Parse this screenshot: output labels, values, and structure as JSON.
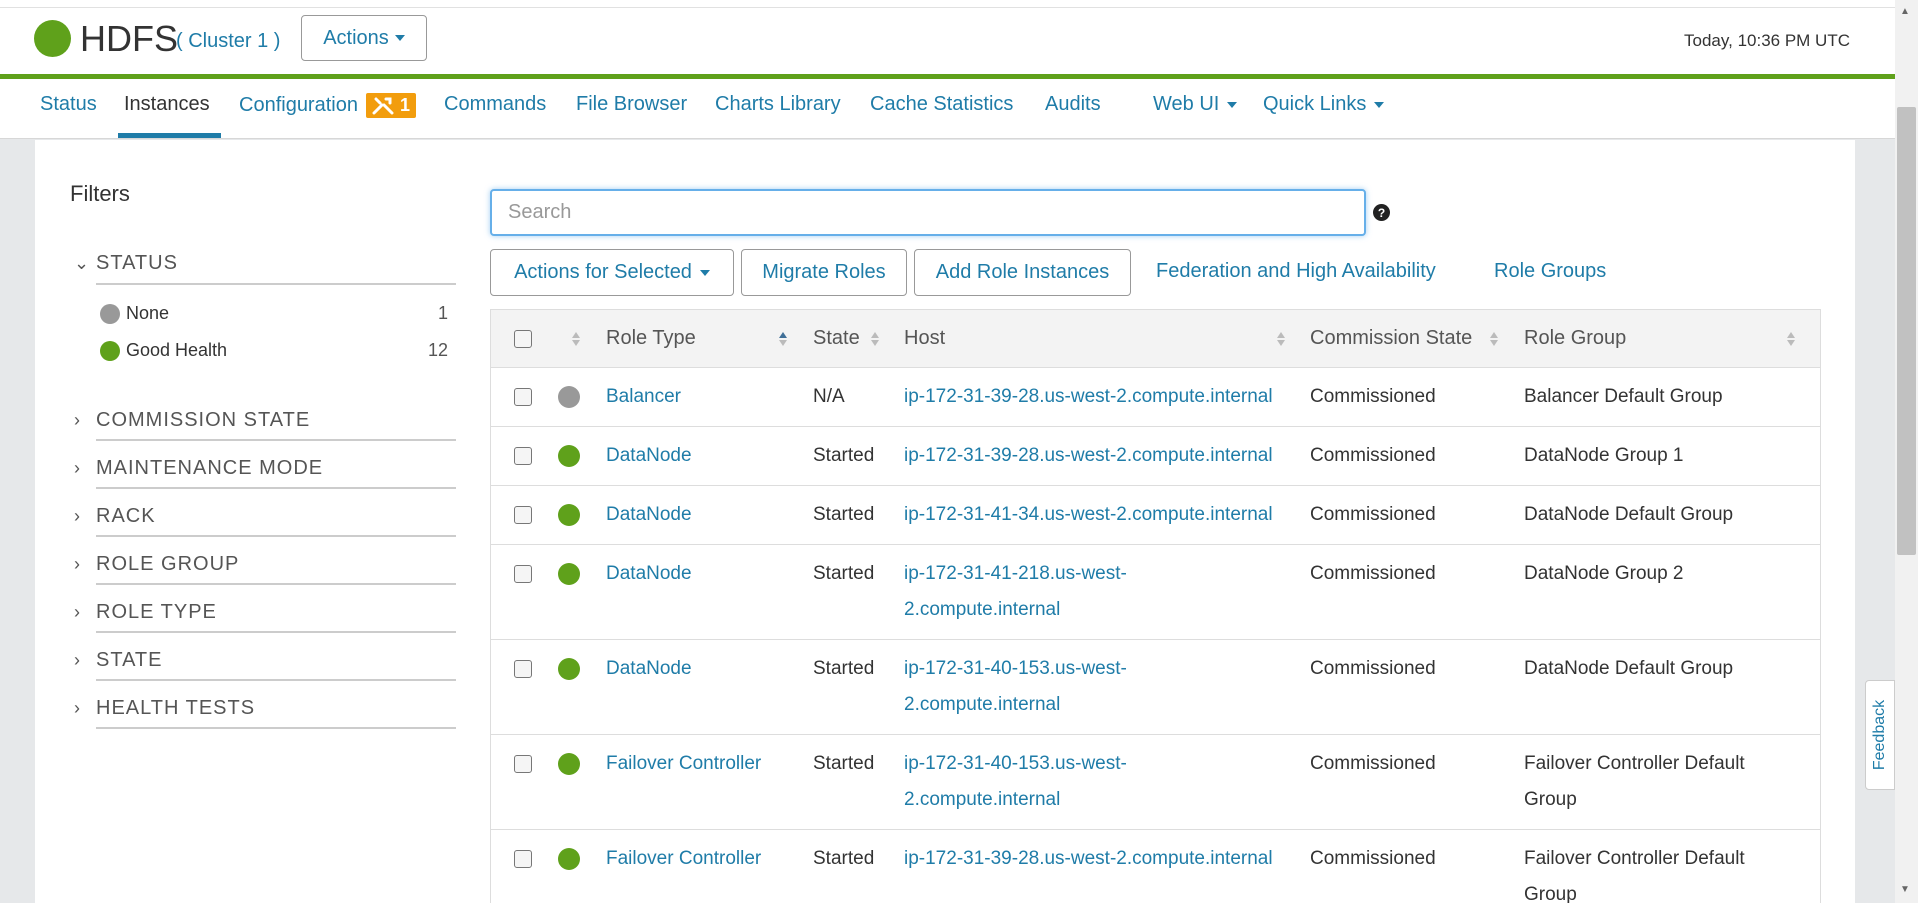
{
  "header": {
    "service": "HDFS",
    "cluster": "( Cluster 1 )",
    "actions_label": "Actions",
    "time": "Today, 10:36 PM UTC"
  },
  "nav": {
    "status": "Status",
    "instances": "Instances",
    "configuration": "Configuration",
    "config_badge": "1",
    "commands": "Commands",
    "file_browser": "File Browser",
    "charts_library": "Charts Library",
    "cache_statistics": "Cache Statistics",
    "audits": "Audits",
    "web_ui": "Web UI",
    "quick_links": "Quick Links"
  },
  "filters": {
    "title": "Filters",
    "status": {
      "label": "STATUS",
      "options": [
        {
          "label": "None",
          "count": "1",
          "color": "#999999"
        },
        {
          "label": "Good Health",
          "count": "12",
          "color": "#5fa11b"
        }
      ]
    },
    "commission_state": "COMMISSION STATE",
    "maintenance_mode": "MAINTENANCE MODE",
    "rack": "RACK",
    "role_group": "ROLE GROUP",
    "role_type": "ROLE TYPE",
    "state": "STATE",
    "health_tests": "HEALTH TESTS"
  },
  "search": {
    "placeholder": "Search",
    "help": "?"
  },
  "toolbar": {
    "actions_for_selected": "Actions for Selected",
    "migrate_roles": "Migrate Roles",
    "add_role_instances": "Add Role Instances",
    "federation": "Federation and High Availability",
    "role_groups": "Role Groups"
  },
  "table": {
    "headers": {
      "role_type": "Role Type",
      "state": "State",
      "host": "Host",
      "commission_state": "Commission State",
      "role_group": "Role Group"
    },
    "rows": [
      {
        "status_color": "#999999",
        "role_type": "Balancer",
        "state": "N/A",
        "host": "ip-172-31-39-28.us-west-2.compute.internal",
        "commission": "Commissioned",
        "group": "Balancer Default Group"
      },
      {
        "status_color": "#5fa11b",
        "role_type": "DataNode",
        "state": "Started",
        "host": "ip-172-31-39-28.us-west-2.compute.internal",
        "commission": "Commissioned",
        "group": "DataNode Group 1"
      },
      {
        "status_color": "#5fa11b",
        "role_type": "DataNode",
        "state": "Started",
        "host": "ip-172-31-41-34.us-west-2.compute.internal",
        "commission": "Commissioned",
        "group": "DataNode Default Group"
      },
      {
        "status_color": "#5fa11b",
        "role_type": "DataNode",
        "state": "Started",
        "host": "ip-172-31-41-218.us-west-2.compute.internal",
        "commission": "Commissioned",
        "group": "DataNode Group 2"
      },
      {
        "status_color": "#5fa11b",
        "role_type": "DataNode",
        "state": "Started",
        "host": "ip-172-31-40-153.us-west-2.compute.internal",
        "commission": "Commissioned",
        "group": "DataNode Default Group"
      },
      {
        "status_color": "#5fa11b",
        "role_type": "Failover Controller",
        "state": "Started",
        "host": "ip-172-31-40-153.us-west-2.compute.internal",
        "commission": "Commissioned",
        "group": "Failover Controller Default Group"
      },
      {
        "status_color": "#5fa11b",
        "role_type": "Failover Controller",
        "state": "Started",
        "host": "ip-172-31-39-28.us-west-2.compute.internal",
        "commission": "Commissioned",
        "group": "Failover Controller Default Group"
      }
    ]
  },
  "feedback": "Feedback",
  "colors": {
    "brand_green": "#5fa11b",
    "link_blue": "#1f7ca8",
    "badge_orange": "#f29d0d"
  }
}
